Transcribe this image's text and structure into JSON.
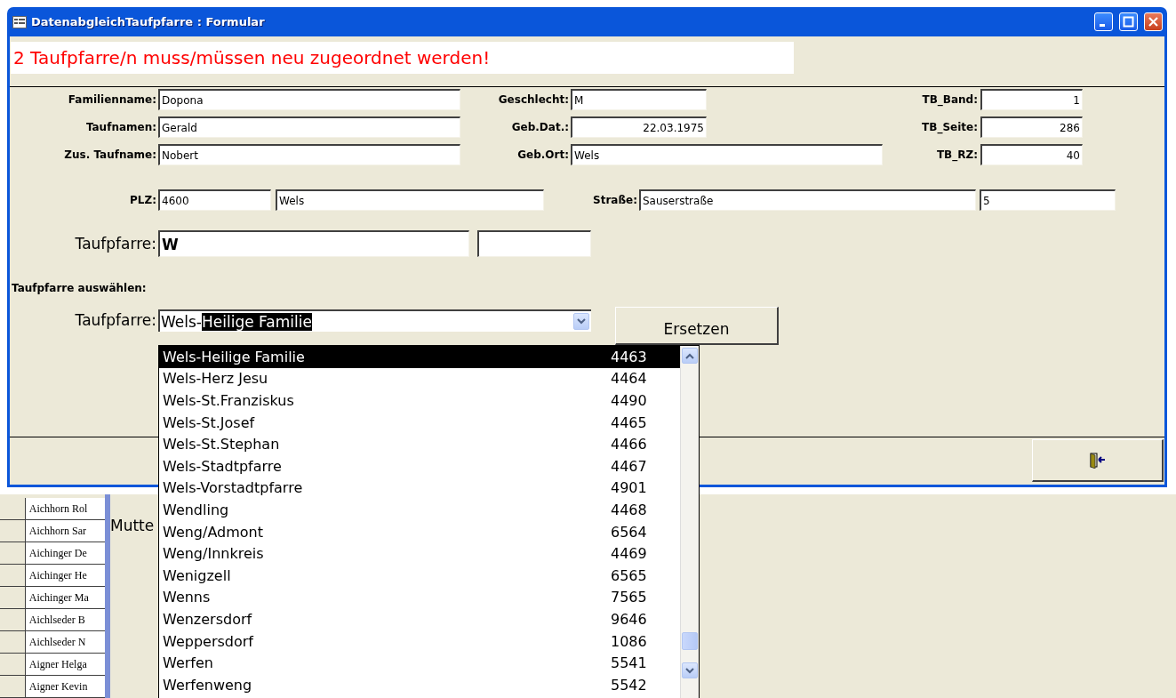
{
  "window": {
    "title": "DatenabgleichTaufpfarre : Formular"
  },
  "message": "2 Taufpfarre/n muss/müssen neu zugeordnet werden!",
  "rows": [
    [
      {
        "label": "Familienname:",
        "value": "Dopona"
      },
      {
        "label": "Geschlecht:",
        "value": "M"
      },
      {
        "label": "TB_Band:",
        "value": "1"
      }
    ],
    [
      {
        "label": "Taufnamen:",
        "value": "Gerald"
      },
      {
        "label": "Geb.Dat.:",
        "value": "22.03.1975"
      },
      {
        "label": "TB_Seite:",
        "value": "286"
      }
    ],
    [
      {
        "label": "Zus. Taufname:",
        "value": "Nobert"
      },
      {
        "label": "Geb.Ort:",
        "value": "Wels"
      },
      {
        "label": "TB_RZ:",
        "value": "40"
      }
    ],
    [
      {
        "label": "PLZ:",
        "value": "4600"
      },
      {
        "value": "Wels"
      },
      {
        "label": "Straße:",
        "value": "Sauserstraße"
      },
      {
        "value": "5"
      }
    ],
    [
      {
        "label": "Taufpfarre:",
        "value": "W"
      },
      {}
    ]
  ],
  "section_label": "Taufpfarre auswählen:",
  "combo": {
    "label": "Taufpfarre:",
    "typed": "Wels-",
    "completed": "Heilige Familie"
  },
  "replace_button": "Ersetzen",
  "dropdown": [
    {
      "name": "Wels-Heilige Familie",
      "code": "4463",
      "selected": true
    },
    {
      "name": "Wels-Herz Jesu",
      "code": "4464",
      "selected": false
    },
    {
      "name": "Wels-St.Franziskus",
      "code": "4490",
      "selected": false
    },
    {
      "name": "Wels-St.Josef",
      "code": "4465",
      "selected": false
    },
    {
      "name": "Wels-St.Stephan",
      "code": "4466",
      "selected": false
    },
    {
      "name": "Wels-Stadtpfarre",
      "code": "4467",
      "selected": false
    },
    {
      "name": "Wels-Vorstadtpfarre",
      "code": "4901",
      "selected": false
    },
    {
      "name": "Wendling",
      "code": "4468",
      "selected": false
    },
    {
      "name": "Weng/Admont",
      "code": "6564",
      "selected": false
    },
    {
      "name": "Weng/Innkreis",
      "code": "4469",
      "selected": false
    },
    {
      "name": "Wenigzell",
      "code": "6565",
      "selected": false
    },
    {
      "name": "Wenns",
      "code": "7565",
      "selected": false
    },
    {
      "name": "Wenzersdorf",
      "code": "9646",
      "selected": false
    },
    {
      "name": "Weppersdorf",
      "code": "1086",
      "selected": false
    },
    {
      "name": "Werfen",
      "code": "5541",
      "selected": false
    },
    {
      "name": "Werfenweng",
      "code": "5542",
      "selected": false
    }
  ],
  "background": {
    "names": [
      "Aichhorn Rol",
      "Aichhorn Sar",
      "Aichinger De",
      "Aichinger He",
      "Aichinger Ma",
      "Aichlseder B",
      "Aichlseder N",
      "Aigner Helga",
      "Aigner Kevin"
    ],
    "heading": "Mutte"
  }
}
